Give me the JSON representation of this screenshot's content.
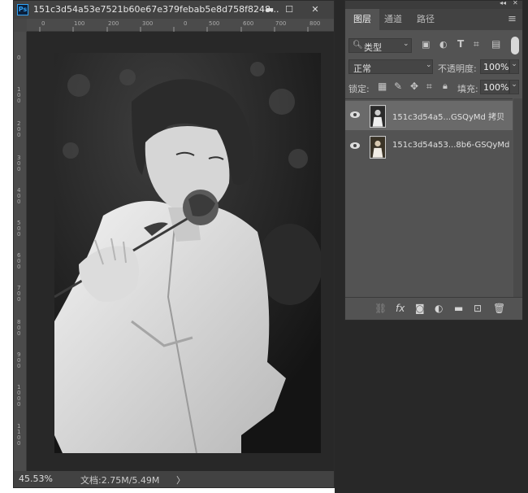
{
  "document": {
    "title": "151c3d54a53e7521b60e67e379febab5e8d758f8248...",
    "ps_badge": "Ps",
    "buttons": {
      "minimize": "▬",
      "maximize": "☐",
      "close": "✕"
    },
    "ruler_top_labels": [
      "0",
      "100",
      "200",
      "300",
      "0",
      "500",
      "600",
      "700",
      "800"
    ],
    "ruler_left_labels": [
      "0",
      "1 0 0",
      "2 0 0",
      "3 0 0",
      "4 0 0",
      "5 0 0",
      "6 0 0",
      "7 0 0",
      "8 0 0",
      "9 0 0",
      "1 0 0 0",
      "1 1 0 0"
    ],
    "zoom": "45.53%",
    "doc_size": "文档:2.75M/5.49M",
    "status_arrow": "〉"
  },
  "layers_panel": {
    "header_glyphs": {
      "collapse": "◂◂",
      "close": "✕"
    },
    "tabs": [
      "图层",
      "通道",
      "路径"
    ],
    "menu_icon": "≡",
    "filter": {
      "label": "类型",
      "icons": [
        "image-filter-icon",
        "adjustment-filter-icon",
        "type-filter-icon",
        "shape-filter-icon",
        "smart-object-filter-icon"
      ]
    },
    "blend_mode": "正常",
    "opacity_label": "不透明度:",
    "opacity_value": "100%",
    "lock_label": "锁定:",
    "fill_label": "填充:",
    "fill_value": "100%",
    "layers": [
      {
        "name": "151c3d54a5...GSQyMd 拷贝",
        "selected": true,
        "visible": true
      },
      {
        "name": "151c3d54a53...8b6-GSQyMd",
        "selected": false,
        "visible": true
      }
    ],
    "bottom_icons": [
      "link-icon",
      "fx-icon",
      "mask-icon",
      "adjustment-icon",
      "group-folder-icon",
      "new-layer-icon",
      "trash-icon"
    ]
  },
  "colors": {
    "panel_bg": "#535353",
    "dark_bg": "#282828",
    "selected_layer": "#6a6a6a",
    "accent_blue": "#2fa3f7"
  }
}
